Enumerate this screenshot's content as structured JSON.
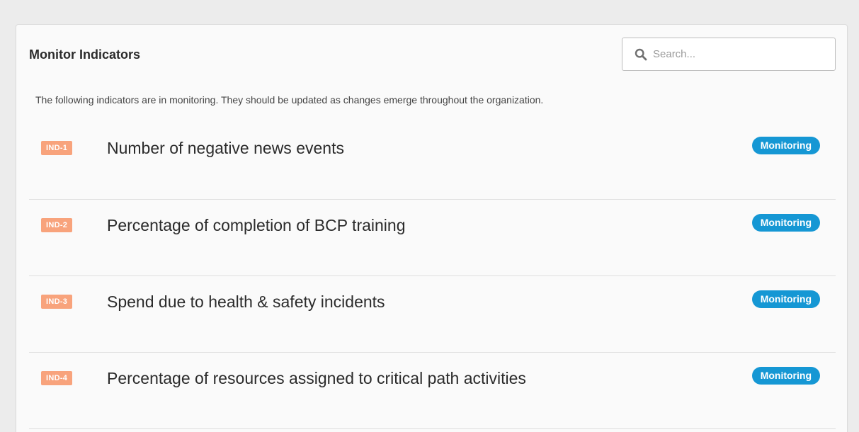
{
  "panel": {
    "title": "Monitor Indicators",
    "description": "The following indicators are in monitoring. They should be updated as changes emerge throughout the organization."
  },
  "search": {
    "placeholder": "Search...",
    "value": "",
    "icon": "search-icon"
  },
  "indicators": [
    {
      "id": "IND-1",
      "title": "Number of negative news events",
      "status": "Monitoring"
    },
    {
      "id": "IND-2",
      "title": "Percentage of completion of BCP training",
      "status": "Monitoring"
    },
    {
      "id": "IND-3",
      "title": "Spend due to health & safety incidents",
      "status": "Monitoring"
    },
    {
      "id": "IND-4",
      "title": "Percentage of resources assigned to critical path activities",
      "status": "Monitoring"
    }
  ],
  "colors": {
    "id_badge": "#f8a37c",
    "status_badge": "#1597d4",
    "page_background": "#ececec",
    "panel_background": "#fafafa"
  }
}
